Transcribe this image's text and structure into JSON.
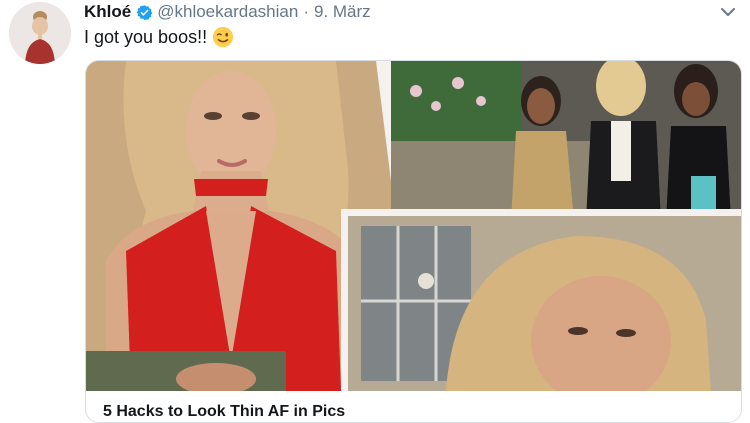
{
  "tweet": {
    "display_name": "Khloé",
    "handle": "@khloekardashian",
    "separator": "·",
    "date": "9. März",
    "text": "I got you boos!!",
    "emoji_icon": "winking-face-icon"
  },
  "card": {
    "title": "5 Hacks to Look Thin AF in Pics"
  },
  "colors": {
    "verified_blue": "#1da1f2",
    "meta_gray": "#657786",
    "dress_red": "#d41f1f"
  }
}
